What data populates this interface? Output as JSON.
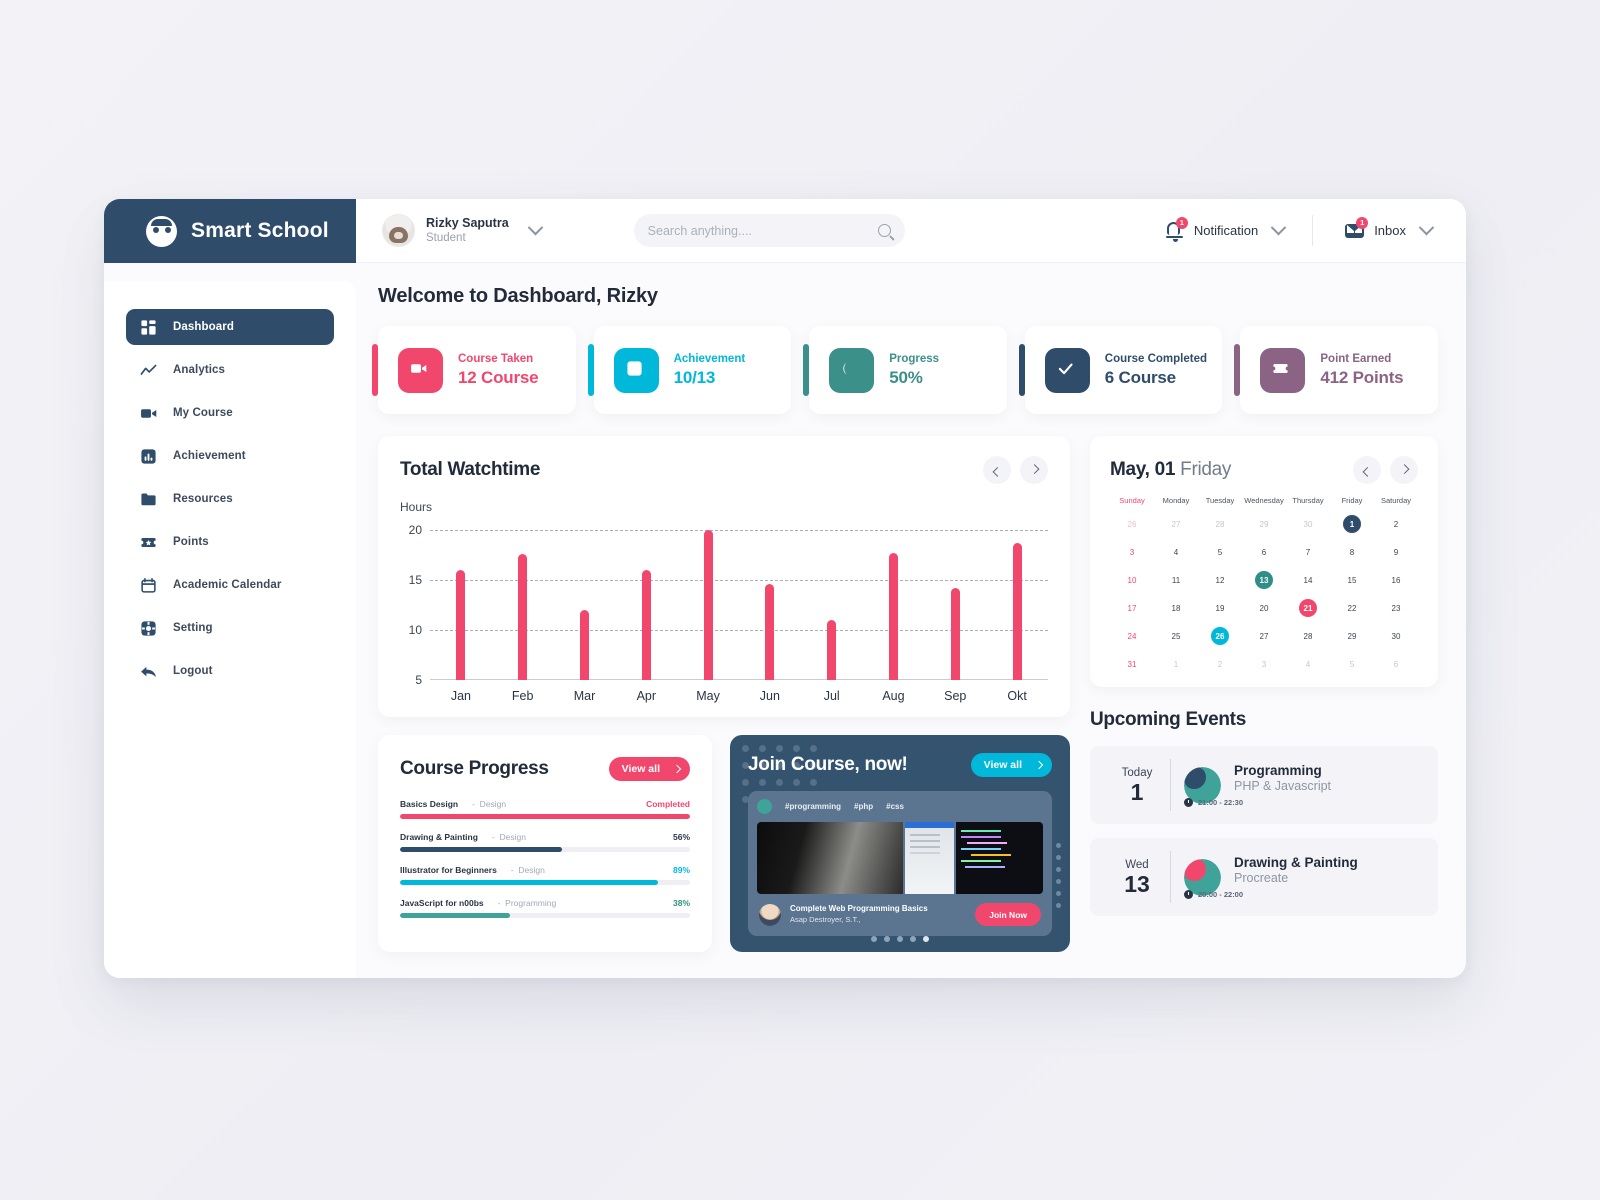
{
  "brand": {
    "name": "Smart School",
    "logo_icon": "face-logo-icon"
  },
  "header": {
    "user": {
      "name": "Rizky Saputra",
      "role": "Student",
      "avatar_icon": "user-avatar",
      "chevron_icon": "chevron-down-icon"
    },
    "search": {
      "placeholder": "Search anything....",
      "value": "",
      "icon": "search-icon"
    },
    "notification": {
      "label": "Notification",
      "badge": "1",
      "icon": "bell-icon",
      "chevron_icon": "chevron-down-icon"
    },
    "inbox": {
      "label": "Inbox",
      "badge": "1",
      "icon": "envelope-icon",
      "chevron_icon": "chevron-down-icon"
    }
  },
  "sidebar": {
    "items": [
      {
        "label": "Dashboard",
        "icon": "grid-icon",
        "active": true
      },
      {
        "label": "Analytics",
        "icon": "line-chart-icon",
        "active": false
      },
      {
        "label": "My Course",
        "icon": "video-camera-icon",
        "active": false
      },
      {
        "label": "Achievement",
        "icon": "bar-chart-icon",
        "active": false
      },
      {
        "label": "Resources",
        "icon": "folder-icon",
        "active": false
      },
      {
        "label": "Points",
        "icon": "ticket-star-icon",
        "active": false
      },
      {
        "label": "Academic Calendar",
        "icon": "calendar-icon",
        "active": false
      },
      {
        "label": "Setting",
        "icon": "gear-icon",
        "active": false
      },
      {
        "label": "Logout",
        "icon": "back-arrow-icon",
        "active": false
      }
    ]
  },
  "main": {
    "welcome": "Welcome to Dashboard, Rizky",
    "stats": [
      {
        "label": "Course Taken",
        "value": "12 Course",
        "color": "#f2476d",
        "icon": "video-camera-icon"
      },
      {
        "label": "Achievement",
        "value": "10/13",
        "color": "#00b8d9",
        "icon": "bar-chart-icon"
      },
      {
        "label": "Progress",
        "value": "50%",
        "color": "#3b9089",
        "icon": "half-moon-icon"
      },
      {
        "label": "Course Completed",
        "value": "6 Course",
        "color": "#2f4d6b",
        "icon": "check-icon"
      },
      {
        "label": "Point Earned",
        "value": "412 Points",
        "color": "#8b6385",
        "icon": "ticket-star-icon"
      }
    ]
  },
  "chart_data": {
    "type": "bar",
    "title": "Total Watchtime",
    "ylabel": "Hours",
    "xlabel": "",
    "categories": [
      "Jan",
      "Feb",
      "Mar",
      "Apr",
      "May",
      "Jun",
      "Jul",
      "Aug",
      "Sep",
      "Okt"
    ],
    "values": [
      16,
      17.6,
      12,
      16,
      20,
      14.6,
      11,
      17.7,
      14.2,
      18.7
    ],
    "yticks": [
      20,
      15,
      10,
      5
    ],
    "ylim": [
      5,
      21
    ],
    "grid": true,
    "bar_color": "#f2476d",
    "legend": null,
    "nav": {
      "prev_icon": "chevron-left-icon",
      "next_icon": "chevron-right-icon"
    }
  },
  "course_progress": {
    "title": "Course Progress",
    "view_all": "View all",
    "view_all_chevron": "chevron-right-icon",
    "rows": [
      {
        "name": "Basics Design",
        "sep": "-",
        "category": "Design",
        "value": "Completed",
        "percent": 100,
        "color": "#f2476d",
        "value_color": "#f2476d"
      },
      {
        "name": "Drawing & Painting",
        "sep": "-",
        "category": "Design",
        "value": "56%",
        "percent": 56,
        "color": "#2f4d6b",
        "value_color": "#2b3445"
      },
      {
        "name": "Illustrator for Beginners",
        "sep": "-",
        "category": "Design",
        "value": "89%",
        "percent": 89,
        "color": "#00b8d9",
        "value_color": "#00b8d9"
      },
      {
        "name": "JavaScript for n00bs",
        "sep": "-",
        "category": "Programming",
        "value": "38%",
        "percent": 38,
        "color": "#3fa39a",
        "value_color": "#2f8f86"
      }
    ]
  },
  "join_course": {
    "title": "Join Course, now!",
    "view_all": "View all",
    "view_all_chevron": "chevron-right-icon",
    "tags": [
      "#programming",
      "#php",
      "#css"
    ],
    "course_name": "Complete Web Programming Basics",
    "instructor": "Asap Destroyer, S.T.,",
    "join_label": "Join Now",
    "pager_count": 5,
    "pager_active_index": 4
  },
  "calendar": {
    "month_day": "May, 01",
    "weekday": "Friday",
    "nav": {
      "prev_icon": "chevron-left-icon",
      "next_icon": "chevron-right-icon"
    },
    "dow": [
      "Sunday",
      "Monday",
      "Tuesday",
      "Wednesday",
      "Thursday",
      "Friday",
      "Saturday"
    ],
    "weeks": [
      [
        {
          "d": "26",
          "s": "mut-sun"
        },
        {
          "d": "27",
          "s": "mut"
        },
        {
          "d": "28",
          "s": "mut"
        },
        {
          "d": "29",
          "s": "mut"
        },
        {
          "d": "30",
          "s": "mut"
        },
        {
          "d": "1",
          "s": "sel"
        },
        {
          "d": "2",
          "s": ""
        }
      ],
      [
        {
          "d": "3",
          "s": "sun"
        },
        {
          "d": "4",
          "s": ""
        },
        {
          "d": "5",
          "s": ""
        },
        {
          "d": "6",
          "s": ""
        },
        {
          "d": "7",
          "s": ""
        },
        {
          "d": "8",
          "s": ""
        },
        {
          "d": "9",
          "s": ""
        }
      ],
      [
        {
          "d": "10",
          "s": "sun"
        },
        {
          "d": "11",
          "s": ""
        },
        {
          "d": "12",
          "s": ""
        },
        {
          "d": "13",
          "s": "teal"
        },
        {
          "d": "14",
          "s": ""
        },
        {
          "d": "15",
          "s": ""
        },
        {
          "d": "16",
          "s": ""
        }
      ],
      [
        {
          "d": "17",
          "s": "sun"
        },
        {
          "d": "18",
          "s": ""
        },
        {
          "d": "19",
          "s": ""
        },
        {
          "d": "20",
          "s": ""
        },
        {
          "d": "21",
          "s": "pink"
        },
        {
          "d": "22",
          "s": ""
        },
        {
          "d": "23",
          "s": ""
        }
      ],
      [
        {
          "d": "24",
          "s": "sun"
        },
        {
          "d": "25",
          "s": ""
        },
        {
          "d": "26",
          "s": "cyan"
        },
        {
          "d": "27",
          "s": ""
        },
        {
          "d": "28",
          "s": ""
        },
        {
          "d": "29",
          "s": ""
        },
        {
          "d": "30",
          "s": ""
        }
      ],
      [
        {
          "d": "31",
          "s": "sun"
        },
        {
          "d": "1",
          "s": "mut"
        },
        {
          "d": "2",
          "s": "mut"
        },
        {
          "d": "3",
          "s": "mut"
        },
        {
          "d": "4",
          "s": "mut"
        },
        {
          "d": "5",
          "s": "mut"
        },
        {
          "d": "6",
          "s": "mut"
        }
      ]
    ]
  },
  "events": {
    "title": "Upcoming Events",
    "items": [
      {
        "dow": "Today",
        "day": "1",
        "name": "Programming",
        "sub": "PHP & Javascript",
        "time": "21:00 - 22:30",
        "color_a": "#2f4d6b",
        "color_b": "#3fa39a",
        "clock_icon": "clock-icon"
      },
      {
        "dow": "Wed",
        "day": "13",
        "name": "Drawing & Painting",
        "sub": "Procreate",
        "time": "20:00 - 22:00",
        "color_a": "#f2476d",
        "color_b": "#3fa39a",
        "clock_icon": "clock-icon"
      }
    ]
  }
}
